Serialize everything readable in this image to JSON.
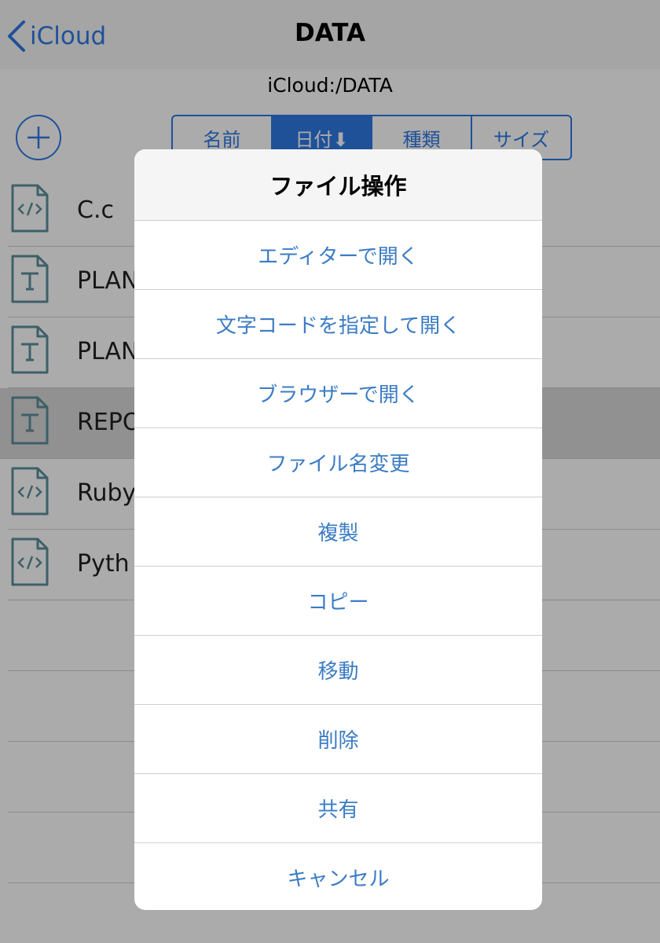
{
  "navbar": {
    "back_label": "iCloud",
    "title": "DATA",
    "path": "iCloud:/DATA"
  },
  "sort_tabs": [
    {
      "label": "名前",
      "active": false
    },
    {
      "label": "日付⬇",
      "active": true
    },
    {
      "label": "種類",
      "active": false
    },
    {
      "label": "サイズ",
      "active": false
    }
  ],
  "files": [
    {
      "name": "C.c",
      "icon": "code-file-icon"
    },
    {
      "name": "PLAN",
      "icon": "text-file-icon"
    },
    {
      "name": "PLAN",
      "icon": "text-file-icon"
    },
    {
      "name": "REPO",
      "icon": "text-file-icon",
      "selected": true
    },
    {
      "name": "Ruby",
      "icon": "code-file-icon"
    },
    {
      "name": "Pyth",
      "icon": "code-file-icon"
    }
  ],
  "action_sheet": {
    "title": "ファイル操作",
    "items": [
      "エディターで開く",
      "文字コードを指定して開く",
      "ブラウザーで開く",
      "ファイル名変更",
      "複製",
      "コピー",
      "移動",
      "削除",
      "共有",
      "キャンセル"
    ]
  },
  "colors": {
    "accent": "#2f7ae5",
    "sheet_text": "#3b7cc4",
    "icon": "#5d8f9b"
  }
}
